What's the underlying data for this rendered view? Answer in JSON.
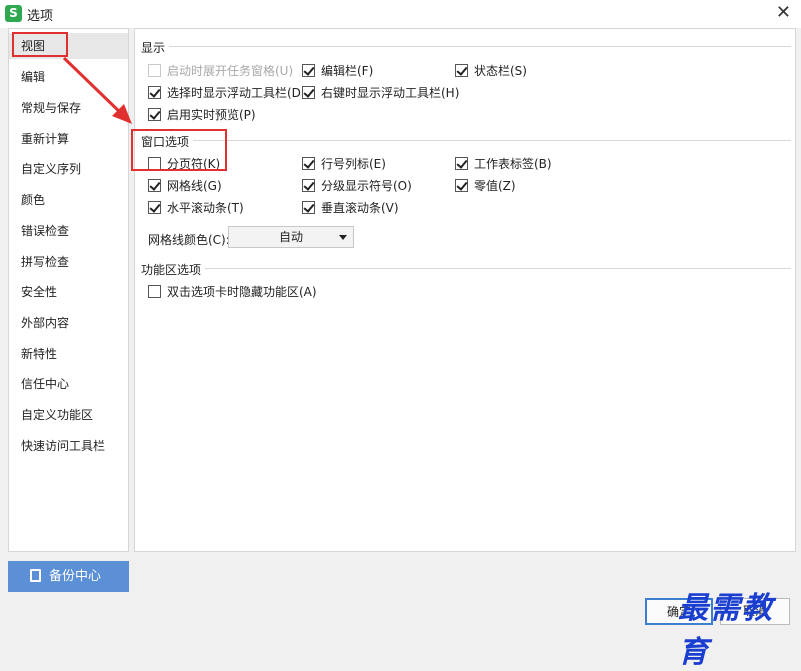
{
  "window": {
    "title": "选项",
    "app_icon": "S",
    "close_glyph": "✕"
  },
  "sidebar": {
    "items": [
      {
        "label": "视图"
      },
      {
        "label": "编辑"
      },
      {
        "label": "常规与保存"
      },
      {
        "label": "重新计算"
      },
      {
        "label": "自定义序列"
      },
      {
        "label": "颜色"
      },
      {
        "label": "错误检查"
      },
      {
        "label": "拼写检查"
      },
      {
        "label": "安全性"
      },
      {
        "label": "外部内容"
      },
      {
        "label": "新特性"
      },
      {
        "label": "信任中心"
      },
      {
        "label": "自定义功能区"
      },
      {
        "label": "快速访问工具栏"
      }
    ],
    "active_index": 0
  },
  "backup": {
    "label": "备份中心"
  },
  "display": {
    "title": "显示",
    "options": [
      {
        "label": "启动时展开任务窗格(U)",
        "checked": false,
        "disabled": true
      },
      {
        "label": "编辑栏(F)",
        "checked": true
      },
      {
        "label": "状态栏(S)",
        "checked": true
      },
      {
        "label": "选择时显示浮动工具栏(D)",
        "checked": true
      },
      {
        "label": "右键时显示浮动工具栏(H)",
        "checked": true
      },
      {
        "label": "启用实时预览(P)",
        "checked": true
      }
    ]
  },
  "window_options": {
    "title": "窗口选项",
    "options": [
      {
        "label": "分页符(K)",
        "checked": false
      },
      {
        "label": "行号列标(E)",
        "checked": true
      },
      {
        "label": "工作表标签(B)",
        "checked": true
      },
      {
        "label": "网格线(G)",
        "checked": true
      },
      {
        "label": "分级显示符号(O)",
        "checked": true
      },
      {
        "label": "零值(Z)",
        "checked": true
      },
      {
        "label": "水平滚动条(T)",
        "checked": true
      },
      {
        "label": "垂直滚动条(V)",
        "checked": true
      }
    ],
    "grid_color_label": "网格线颜色(C):",
    "grid_color_value": "自动"
  },
  "ribbon_options": {
    "title": "功能区选项",
    "options": [
      {
        "label": "双击选项卡时隐藏功能区(A)",
        "checked": false
      }
    ]
  },
  "buttons": {
    "ok": "确定",
    "cancel": "取消"
  },
  "watermark": "最需教育",
  "colors": {
    "accent": "#5b8fd6",
    "highlight": "#e03030",
    "watermark": "#1a3ecf"
  }
}
